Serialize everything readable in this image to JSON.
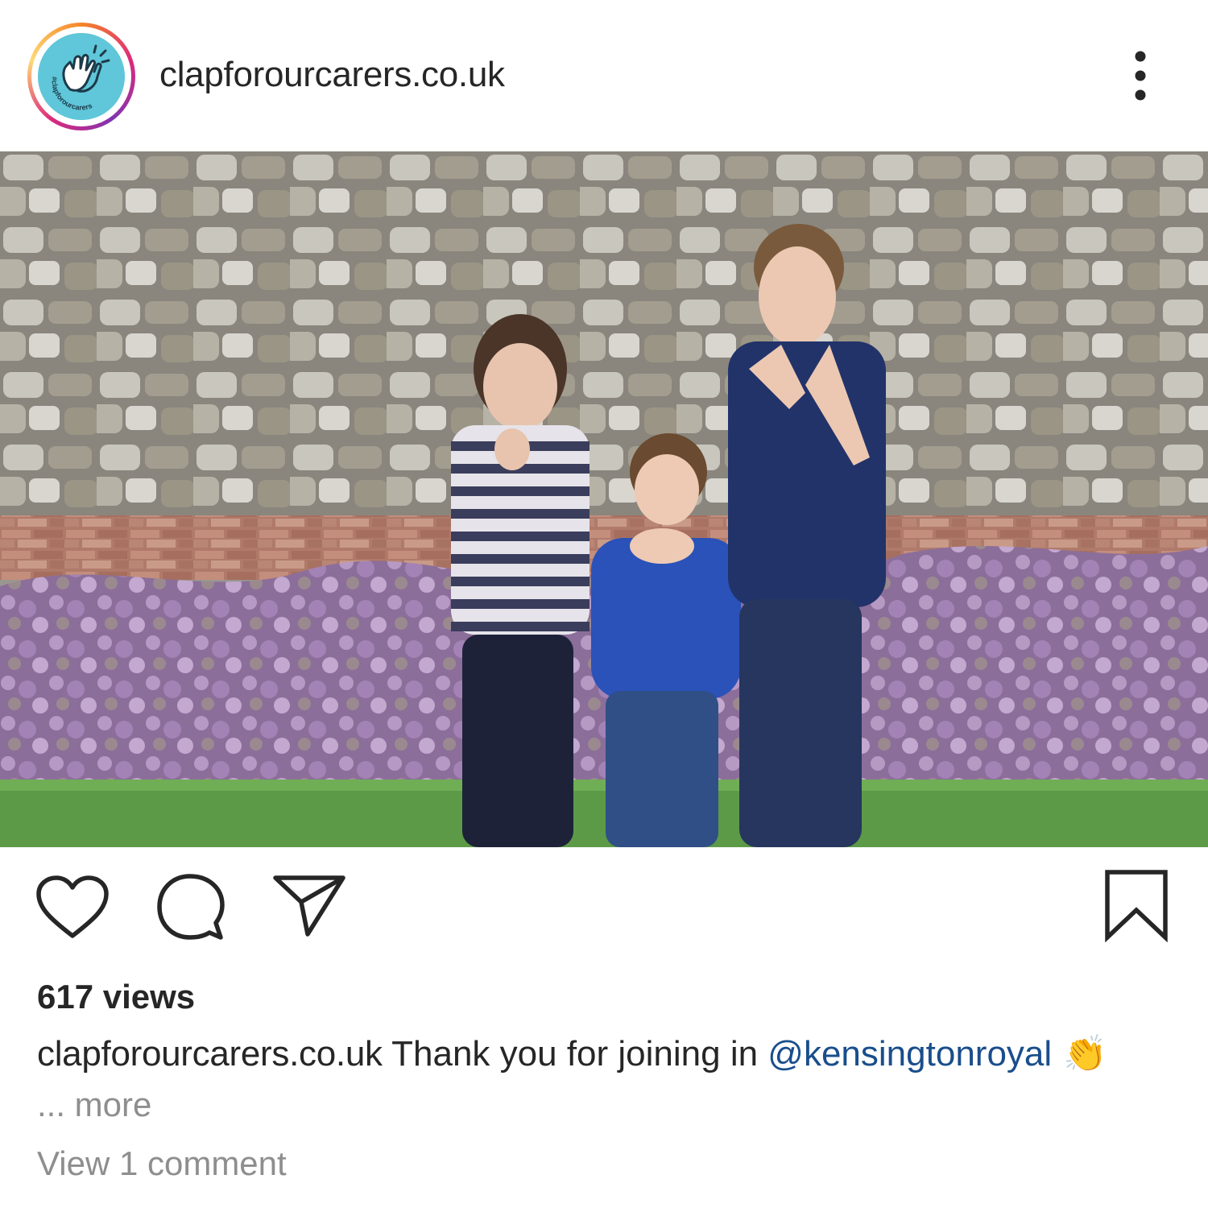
{
  "post": {
    "username": "clapforourcarers.co.uk",
    "avatar_badge_text": "#clapforourcarers",
    "views_text": "617 views",
    "caption": {
      "username": "clapforourcarers.co.uk",
      "text": " Thank you for joining in ",
      "mention": "@kensingtonroyal",
      "emoji": "👏"
    },
    "more_text": "... more",
    "view_comments_text": "View 1 comment"
  },
  "icons": {
    "avatar": "clapping-hands-icon",
    "menu": "more-vertical-icon",
    "like": "heart-icon",
    "comment": "comment-bubble-icon",
    "share": "paper-plane-icon",
    "save": "bookmark-icon"
  },
  "colors": {
    "text": "#262626",
    "secondary_text": "#8e8e8e",
    "mention": "#1a4e8c",
    "avatar_bg": "#5fc7d9"
  }
}
